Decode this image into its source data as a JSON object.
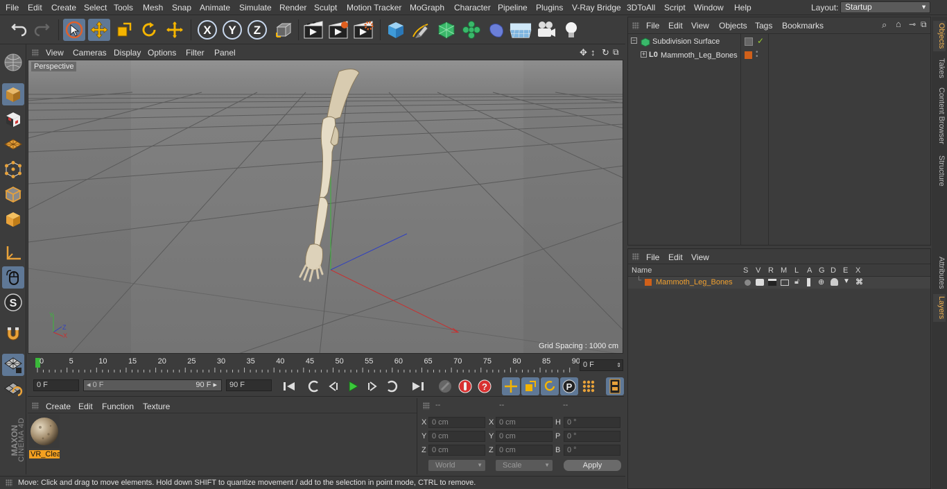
{
  "menubar": {
    "items": [
      "File",
      "Edit",
      "Create",
      "Select",
      "Tools",
      "Mesh",
      "Snap",
      "Animate",
      "Simulate",
      "Render",
      "Sculpt",
      "Motion Tracker",
      "MoGraph",
      "Character",
      "Pipeline",
      "Plugins",
      "V-Ray Bridge",
      "3DToAll",
      "Script",
      "Window",
      "Help"
    ],
    "layout_label": "Layout:",
    "layout_value": "Startup"
  },
  "toolbar": {
    "icons": [
      "undo-icon",
      "redo-icon",
      "live-selection-icon",
      "move-icon",
      "scale-icon",
      "rotate-icon",
      "transform-icon",
      "x-axis-icon",
      "y-axis-icon",
      "z-axis-icon",
      "coordinate-system-icon",
      "render-view-icon",
      "render-picture-viewer-icon",
      "render-settings-icon",
      "cube-icon",
      "pen-icon",
      "subdivision-icon",
      "cloner-icon",
      "deformer-icon",
      "floor-icon",
      "camera-icon",
      "light-icon"
    ],
    "axis_labels": [
      "X",
      "Y",
      "Z"
    ]
  },
  "leftbar": {
    "icons": [
      "make-editable-icon",
      "model-mode-icon",
      "texture-mode-icon",
      "workplane-icon",
      "points-mode-icon",
      "edges-mode-icon",
      "polygons-mode-icon",
      "axis-mode-icon",
      "tweak-mode-icon",
      "soft-selection-icon",
      "magnet-icon",
      "snap-grid-icon",
      "snap-settings-icon"
    ],
    "logo_brand": "MAXON",
    "logo_product": "CINEMA 4D"
  },
  "viewport": {
    "menu": [
      "View",
      "Cameras",
      "Display",
      "Options",
      "Filter",
      "Panel"
    ],
    "label": "Perspective",
    "grid_spacing": "Grid Spacing : 1000 cm"
  },
  "timeline": {
    "ticks": [
      "0",
      "5",
      "10",
      "15",
      "20",
      "25",
      "30",
      "35",
      "40",
      "45",
      "50",
      "55",
      "60",
      "65",
      "70",
      "75",
      "80",
      "85",
      "90"
    ],
    "current_frame": "0 F"
  },
  "transport": {
    "start_field": "0 F",
    "range_start": "0 F",
    "range_end": "90 F",
    "end_field": "90 F"
  },
  "materials": {
    "menu": [
      "Create",
      "Edit",
      "Function",
      "Texture"
    ],
    "items": [
      {
        "label": "VR_Clea"
      }
    ]
  },
  "coordinates": {
    "headers": [
      "--",
      "--",
      "--"
    ],
    "rows": [
      {
        "l1": "X",
        "v1": "0 cm",
        "l2": "X",
        "v2": "0 cm",
        "l3": "H",
        "v3": "0 °"
      },
      {
        "l1": "Y",
        "v1": "0 cm",
        "l2": "Y",
        "v2": "0 cm",
        "l3": "P",
        "v3": "0 °"
      },
      {
        "l1": "Z",
        "v1": "0 cm",
        "l2": "Z",
        "v2": "0 cm",
        "l3": "B",
        "v3": "0 °"
      }
    ],
    "mode_world": "World",
    "mode_scale": "Scale",
    "apply_label": "Apply"
  },
  "status": "Move: Click and drag to move elements. Hold down SHIFT to quantize movement / add to the selection in point mode, CTRL to remove.",
  "objects_panel": {
    "menu": [
      "File",
      "Edit",
      "View",
      "Objects",
      "Tags",
      "Bookmarks"
    ],
    "tree": [
      {
        "name": "Subdivision Surface",
        "level": 0
      },
      {
        "name": "Mammoth_Leg_Bones",
        "level": 1
      }
    ]
  },
  "layers_panel": {
    "menu": [
      "File",
      "Edit",
      "View"
    ],
    "columns": [
      "Name",
      "S",
      "V",
      "R",
      "M",
      "L",
      "A",
      "G",
      "D",
      "E",
      "X"
    ],
    "rows": [
      {
        "name": "Mammoth_Leg_Bones",
        "color": "#d0601a"
      }
    ]
  },
  "right_tabs": [
    "Objects",
    "Takes",
    "Content Browser",
    "Structure",
    "Attributes",
    "Layers"
  ],
  "colors": {
    "accent": "#5f7896",
    "highlight": "#f0a030",
    "layer": "#d0601a"
  }
}
